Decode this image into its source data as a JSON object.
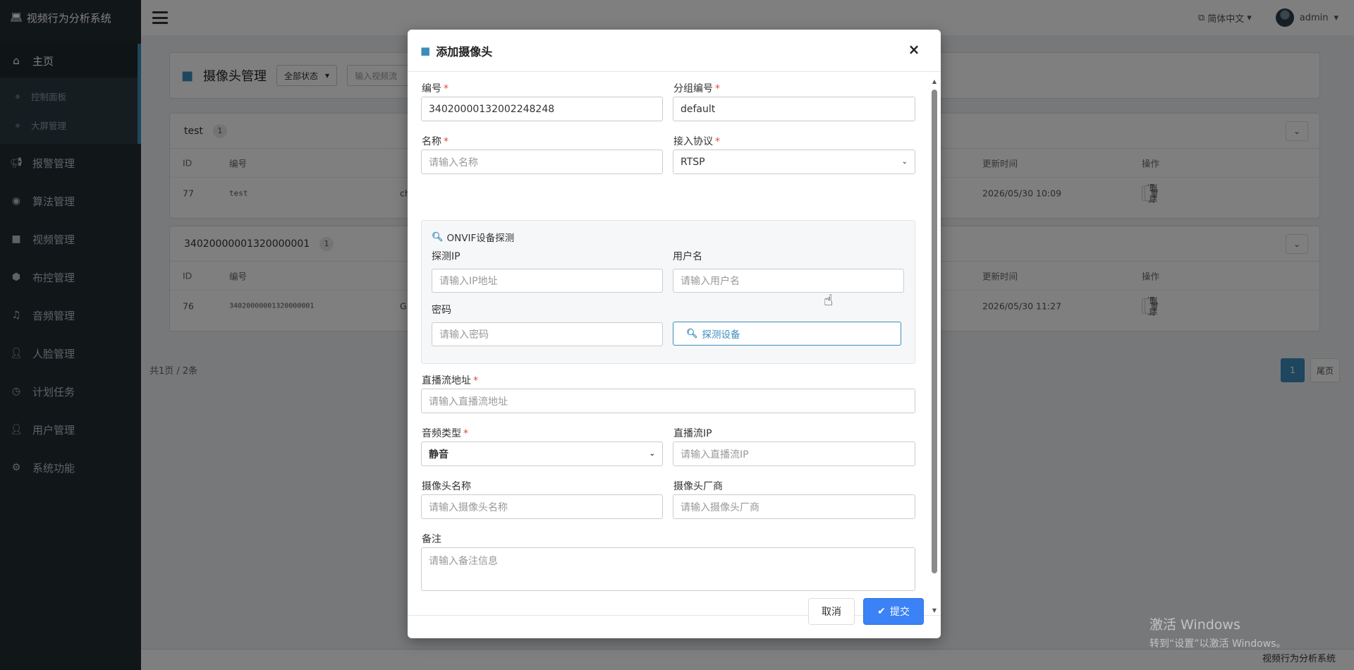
{
  "app": {
    "brand": "视频行为分析系统"
  },
  "sidebar": {
    "main": "主页",
    "sub": [
      "控制面板",
      "大屏管理"
    ],
    "items": [
      {
        "label": "报警管理",
        "icon": "bullhorn-icon"
      },
      {
        "label": "算法管理",
        "icon": "eye-icon"
      },
      {
        "label": "视频管理",
        "icon": "video-camera-icon"
      },
      {
        "label": "布控管理",
        "icon": "cube-icon"
      },
      {
        "label": "音频管理",
        "icon": "music-icon"
      },
      {
        "label": "人脸管理",
        "icon": "user-plus-icon"
      },
      {
        "label": "计划任务",
        "icon": "clock-icon"
      },
      {
        "label": "用户管理",
        "icon": "user-icon"
      },
      {
        "label": "系统功能",
        "icon": "gear-icon"
      }
    ]
  },
  "topbar": {
    "language": "简体中文",
    "user": "admin"
  },
  "page": {
    "title": "摄像头管理",
    "status_filter": "全部状态",
    "search_placeholder": "输入视频流",
    "groups": [
      {
        "name": "test",
        "count": "1",
        "columns": {
          "id": "ID",
          "code": "编号",
          "updated": "更新时间",
          "ops": "操作"
        },
        "rows": [
          {
            "id": "77",
            "code": "test",
            "extra": "ch",
            "updated": "2026/05/30 10:09"
          }
        ]
      },
      {
        "name": "34020000001320000001",
        "count": "1",
        "columns": {
          "id": "ID",
          "code": "编号",
          "updated": "更新时间",
          "ops": "操作"
        },
        "rows": [
          {
            "id": "76",
            "code": "34020000001320000001",
            "extra": "G",
            "updated": "2026/05/30 11:27"
          }
        ]
      }
    ],
    "edit_label": "编辑",
    "delete_label": "删除",
    "pager_info": "共1页 / 2条",
    "pager_current": "1",
    "pager_last": "尾页"
  },
  "modal": {
    "title": "添加摄像头",
    "close": "×",
    "fields": {
      "code": {
        "label": "编号",
        "value": "34020000132002248248"
      },
      "group": {
        "label": "分组编号",
        "value": "default"
      },
      "name": {
        "label": "名称",
        "placeholder": "请输入名称"
      },
      "protocol": {
        "label": "接入协议",
        "value": "RTSP"
      },
      "stream_url": {
        "label": "直播流地址",
        "placeholder": "请输入直播流地址"
      },
      "audio_type": {
        "label": "音频类型",
        "value": "静音"
      },
      "stream_ip": {
        "label": "直播流IP",
        "placeholder": "请输入直播流IP"
      },
      "camera_name": {
        "label": "摄像头名称",
        "placeholder": "请输入摄像头名称"
      },
      "vendor": {
        "label": "摄像头厂商",
        "placeholder": "请输入摄像头厂商"
      },
      "remark": {
        "label": "备注",
        "placeholder": "请输入备注信息"
      }
    },
    "onvif": {
      "title": "ONVIF设备探测",
      "ip": {
        "label": "探测IP",
        "placeholder": "请输入IP地址"
      },
      "username": {
        "label": "用户名",
        "placeholder": "请输入用户名"
      },
      "password": {
        "label": "密码",
        "placeholder": "请输入密码"
      },
      "probe_button": "探测设备"
    },
    "cancel": "取消",
    "submit": "提交"
  },
  "footer": {
    "text": "视频行为分析系统"
  },
  "watermark": {
    "line1": "激活 Windows",
    "line2": "转到“设置”以激活 Windows。"
  },
  "colors": {
    "accent": "#3c8dbc",
    "primary": "#3b82f6",
    "sidebar": "#222d32",
    "required": "#dd4b39"
  }
}
